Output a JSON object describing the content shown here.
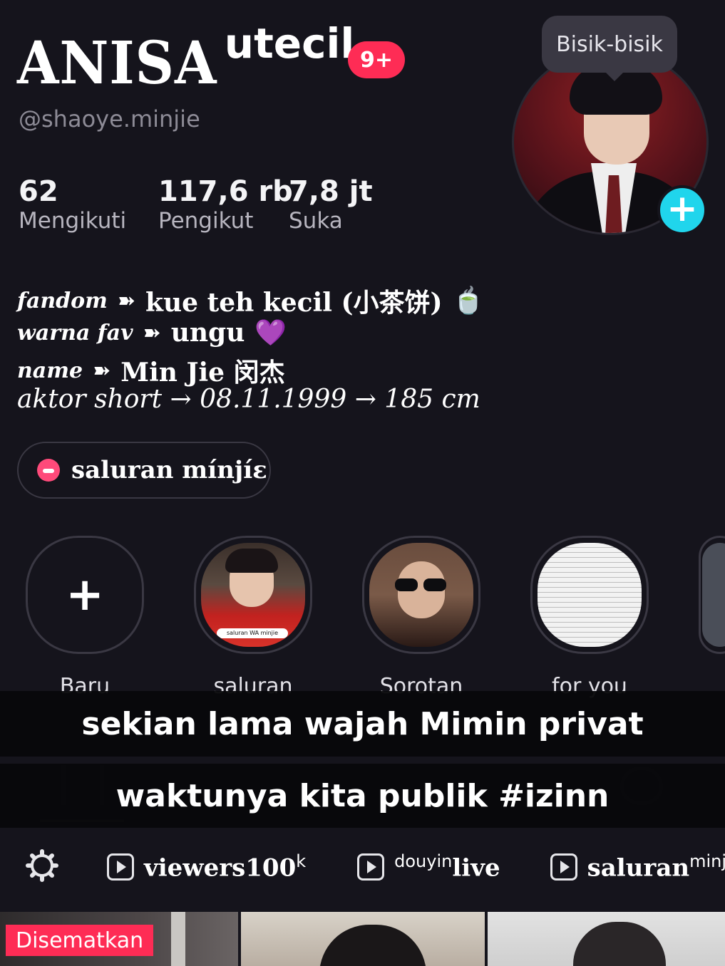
{
  "profile": {
    "name_main": "ANISA",
    "name_sup": "utecil",
    "notif_badge": "9+",
    "handle": "@shaoye.minjie",
    "whisper_label": "Bisik-bisik"
  },
  "stats": [
    {
      "value": "62",
      "label": "Mengikuti"
    },
    {
      "value": "117,6 rb",
      "label": "Pengikut"
    },
    {
      "value": "7,8 jt",
      "label": "Suka"
    }
  ],
  "bio": {
    "line1_key": "fandom",
    "line1_arrow": "➽",
    "line1_val": "kue teh kecil (小茶饼)",
    "line1_emoji": "🍵",
    "line2_key": "warna fav",
    "line2_arrow": "➽",
    "line2_val": "ungu",
    "line2_emoji": "💜",
    "line3_key": "name",
    "line3_arrow": "➽",
    "line3_val": "Min Jie 闵杰",
    "line4": "aktor short → 08.11.1999 → 185 cm"
  },
  "channel": {
    "label": "saluran mínjíε"
  },
  "highlights": [
    {
      "label": "Baru",
      "icon": "plus-icon"
    },
    {
      "label": "saluran",
      "caption": "saluran WA minjie"
    },
    {
      "label": "Sorotan"
    },
    {
      "label": "for you"
    }
  ],
  "subtitles": {
    "line1": "sekian lama wajah Mimin privat",
    "line2": "waktunya kita publik #izinn"
  },
  "playlists": [
    {
      "name": "viewers100",
      "sup": "k"
    },
    {
      "name": "live",
      "prefix": "douyin"
    },
    {
      "name": "saluran",
      "sup": "minjie"
    }
  ],
  "pinned_label": "Disematkan",
  "colors": {
    "accent": "#fe2c55",
    "follow_plus": "#20d5ec",
    "background": "#15141c"
  }
}
